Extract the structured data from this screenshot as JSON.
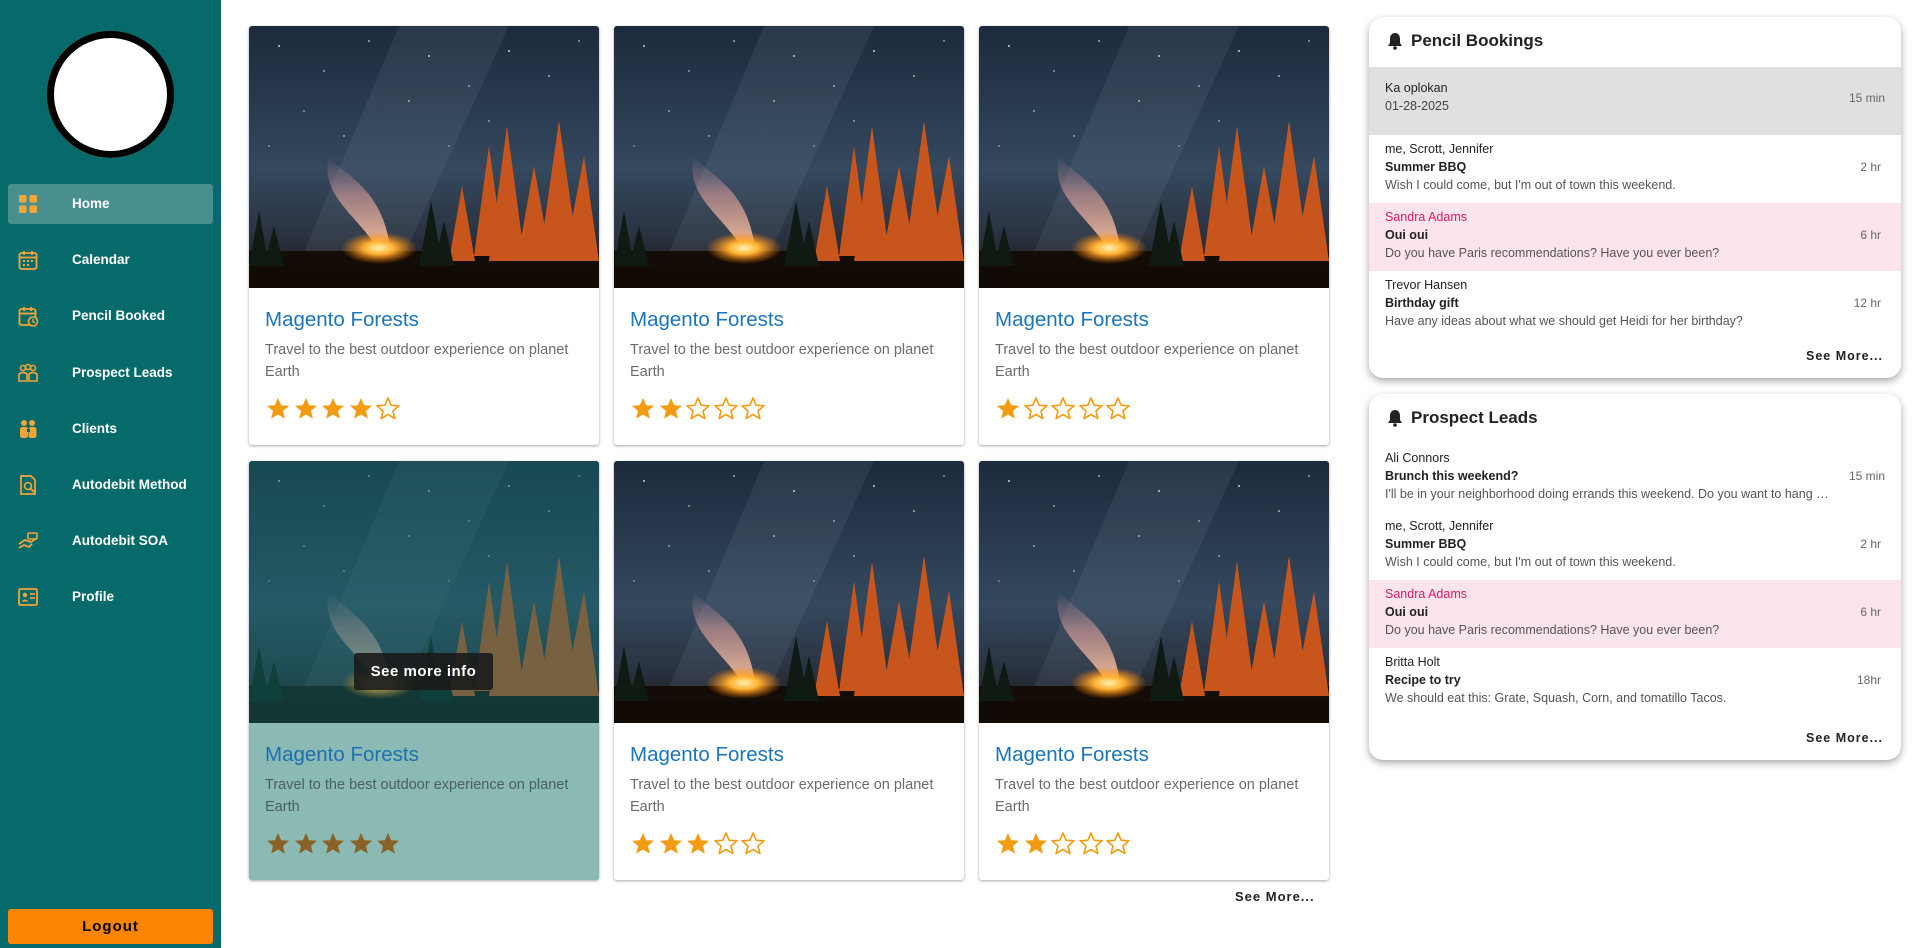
{
  "colors": {
    "sidebar": "#076a6a",
    "active_nav": "#4a8f8f",
    "accent": "#fb8400",
    "title_link": "#1a75bd",
    "star": "#f39c12",
    "pink_row": "#fce4ec"
  },
  "sidebar": {
    "items": [
      {
        "label": "Home",
        "icon": "home-grid-icon"
      },
      {
        "label": "Calendar",
        "icon": "calendar-icon"
      },
      {
        "label": "Pencil Booked",
        "icon": "pencil-booked-calendar-icon"
      },
      {
        "label": "Prospect Leads",
        "icon": "prospect-leads-group-icon"
      },
      {
        "label": "Clients",
        "icon": "clients-icon"
      },
      {
        "label": "Autodebit Method",
        "icon": "autodebit-method-icon"
      },
      {
        "label": "Autodebit SOA",
        "icon": "autodebit-soa-icon"
      },
      {
        "label": "Profile",
        "icon": "profile-card-icon"
      }
    ],
    "logout_label": "Logout"
  },
  "cards": [
    {
      "title": "Magento Forests",
      "description": "Travel to the best outdoor experience on planet Earth",
      "rating": 4
    },
    {
      "title": "Magento Forests",
      "description": "Travel to the best outdoor experience on planet Earth",
      "rating": 2
    },
    {
      "title": "Magento Forests",
      "description": "Travel to the best outdoor experience on planet Earth",
      "rating": 1
    },
    {
      "title": "Magento Forests",
      "description": "Travel to the best outdoor experience on planet Earth",
      "rating": 5,
      "hover_label": "See more info"
    },
    {
      "title": "Magento Forests",
      "description": "Travel to the best outdoor experience on planet Earth",
      "rating": 3
    },
    {
      "title": "Magento Forests",
      "description": "Travel to the best outdoor experience on planet Earth",
      "rating": 2
    }
  ],
  "cards_see_more": "See More...",
  "pencil_bookings": {
    "title": "Pencil Bookings",
    "items": [
      {
        "line1": "Ka oplokan",
        "line2": "01-28-2025",
        "line3": "",
        "time": "15 min"
      },
      {
        "line1": "me, Scrott, Jennifer",
        "line2": "Summer BBQ",
        "line3": "Wish I could come, but I'm out of town this weekend.",
        "time": "2 hr"
      },
      {
        "line1": "Sandra Adams",
        "line2": "Oui oui",
        "line3": "Do you have Paris recommendations? Have you ever been?",
        "time": "6 hr"
      },
      {
        "line1": "Trevor Hansen",
        "line2": "Birthday gift",
        "line3": "Have any ideas about what we should get Heidi for her birthday?",
        "time": "12 hr"
      }
    ],
    "see_more": "See More..."
  },
  "prospect_leads": {
    "title": "Prospect Leads",
    "items": [
      {
        "line1": "Ali Connors",
        "line2": "Brunch this weekend?",
        "line3": "I'll be in your neighborhood doing errands this weekend. Do you want to hang out?",
        "time": "15 min"
      },
      {
        "line1": "me, Scrott, Jennifer",
        "line2": "Summer BBQ",
        "line3": "Wish I could come, but I'm out of town this weekend.",
        "time": "2 hr"
      },
      {
        "line1": "Sandra Adams",
        "line2": "Oui oui",
        "line3": "Do you have Paris recommendations? Have you ever been?",
        "time": "6 hr"
      },
      {
        "line1": "Britta Holt",
        "line2": "Recipe to try",
        "line3": "We should eat this: Grate, Squash, Corn, and tomatillo Tacos.",
        "time": "18hr"
      }
    ],
    "see_more": "See More..."
  }
}
